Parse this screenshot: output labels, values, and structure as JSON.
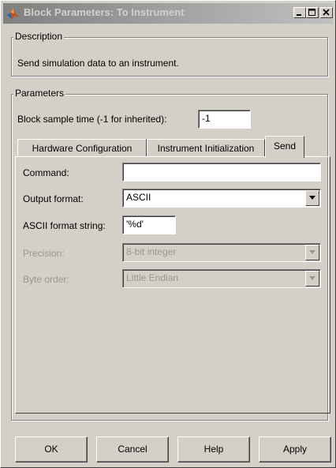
{
  "window": {
    "title": "Block Parameters: To Instrument",
    "controls": [
      "minimize-icon",
      "maximize-icon",
      "close-icon"
    ]
  },
  "description": {
    "group_label": "Description",
    "text": "Send simulation data to an instrument."
  },
  "parameters": {
    "group_label": "Parameters",
    "sample_time_label": "Block sample time (-1 for inherited):",
    "sample_time_value": "-1",
    "tabs": [
      {
        "label": "Hardware Configuration",
        "active": false
      },
      {
        "label": "Instrument Initialization",
        "active": false
      },
      {
        "label": "Send",
        "active": true
      }
    ]
  },
  "send_tab": {
    "command_label": "Command:",
    "command_value": "",
    "output_format_label": "Output format:",
    "output_format_value": "ASCII",
    "ascii_format_label": "ASCII format string:",
    "ascii_format_value": "'%d'",
    "precision_label": "Precision:",
    "precision_value": "8-bit integer",
    "byte_order_label": "Byte order:",
    "byte_order_value": "Little Endian"
  },
  "buttons": {
    "ok": "OK",
    "cancel": "Cancel",
    "help": "Help",
    "apply": "Apply"
  },
  "colors": {
    "dialog_face": "#d4d0c8",
    "title_gradient_start": "#808080",
    "title_gradient_end": "#c0c0c0",
    "disabled_text": "#9a9691"
  }
}
